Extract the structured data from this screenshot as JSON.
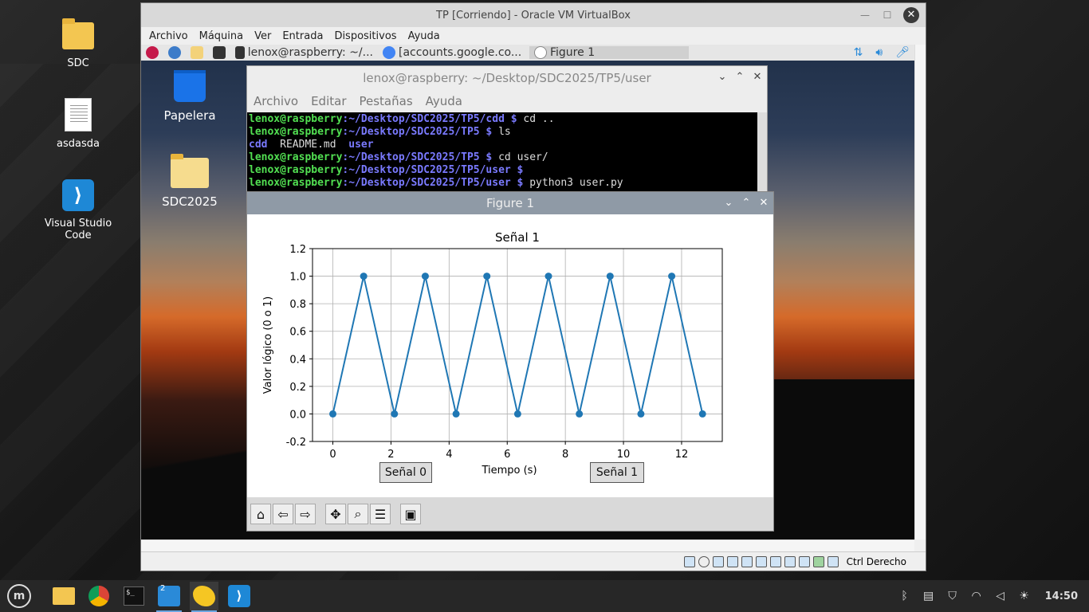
{
  "host_desktop": {
    "icons": [
      {
        "label": "SDC",
        "icon": "folder-icon"
      },
      {
        "label": "asdasda",
        "icon": "document-icon"
      },
      {
        "label": "Visual Studio Code",
        "icon": "vscode-icon"
      }
    ]
  },
  "vbox": {
    "title": "TP [Corriendo] - Oracle VM VirtualBox",
    "menu": [
      "Archivo",
      "Máquina",
      "Ver",
      "Entrada",
      "Dispositivos",
      "Ayuda"
    ],
    "status_text": "Ctrl Derecho"
  },
  "guest": {
    "panel_items": [
      {
        "label": "",
        "icon": "raspberry-icon"
      },
      {
        "label": "",
        "icon": "globe-icon"
      },
      {
        "label": "",
        "icon": "folder-icon"
      },
      {
        "label": "",
        "icon": "terminal-icon"
      },
      {
        "label": "lenox@raspberry: ~/...",
        "icon": "terminal-icon"
      },
      {
        "label": "[accounts.google.co...",
        "icon": "chromium-icon"
      },
      {
        "label": "Figure 1",
        "icon": "figure-icon"
      }
    ],
    "desktop_icons": [
      {
        "label": "Papelera",
        "icon": "trash-icon"
      },
      {
        "label": "SDC2025",
        "icon": "folder-icon"
      }
    ],
    "terminal": {
      "title": "lenox@raspberry: ~/Desktop/SDC2025/TP5/user",
      "menu": [
        "Archivo",
        "Editar",
        "Pestañas",
        "Ayuda"
      ],
      "lines": [
        {
          "user": "lenox@raspberry",
          "path": "~/Desktop/SDC2025/TP5/cdd",
          "cmd": "cd .."
        },
        {
          "user": "lenox@raspberry",
          "path": "~/Desktop/SDC2025/TP5",
          "cmd": "ls"
        },
        {
          "output": [
            "cdd",
            "README.md",
            "user"
          ]
        },
        {
          "user": "lenox@raspberry",
          "path": "~/Desktop/SDC2025/TP5",
          "cmd": "cd user/"
        },
        {
          "user": "lenox@raspberry",
          "path": "~/Desktop/SDC2025/TP5/user",
          "cmd": ""
        },
        {
          "user": "lenox@raspberry",
          "path": "~/Desktop/SDC2025/TP5/user",
          "cmd": "python3 user.py"
        }
      ]
    },
    "figure": {
      "title": "Figure 1",
      "button_left": "Señal 0",
      "button_right": "Señal 1",
      "toolbar": [
        "home-icon",
        "back-icon",
        "forward-icon",
        "pan-icon",
        "zoom-icon",
        "configure-icon",
        "save-icon"
      ]
    }
  },
  "chart_data": {
    "type": "line",
    "title": "Señal 1",
    "xlabel": "Tiempo (s)",
    "ylabel": "Valor lógico (0 o 1)",
    "xlim": [
      -0.7,
      13.4
    ],
    "ylim": [
      -0.2,
      1.2
    ],
    "xticks": [
      0,
      2,
      4,
      6,
      8,
      10,
      12
    ],
    "yticks": [
      -0.2,
      0.0,
      0.2,
      0.4,
      0.6,
      0.8,
      1.0,
      1.2
    ],
    "grid": true,
    "color": "#1f77b4",
    "series": [
      {
        "x": [
          0,
          1.06,
          2.12,
          3.18,
          4.24,
          5.3,
          6.36,
          7.42,
          8.48,
          9.54,
          10.6,
          11.66,
          12.72
        ],
        "y": [
          0,
          1,
          0,
          1,
          0,
          1,
          0,
          1,
          0,
          1,
          0,
          1,
          0
        ]
      }
    ]
  },
  "taskbar": {
    "apps": [
      "mint-menu-icon",
      "files-icon",
      "chrome-icon",
      "terminal-icon",
      "system-monitor-icon",
      "virtualbox-icon",
      "vscode-icon"
    ],
    "monitor_badge": "2",
    "time": "14:50"
  }
}
